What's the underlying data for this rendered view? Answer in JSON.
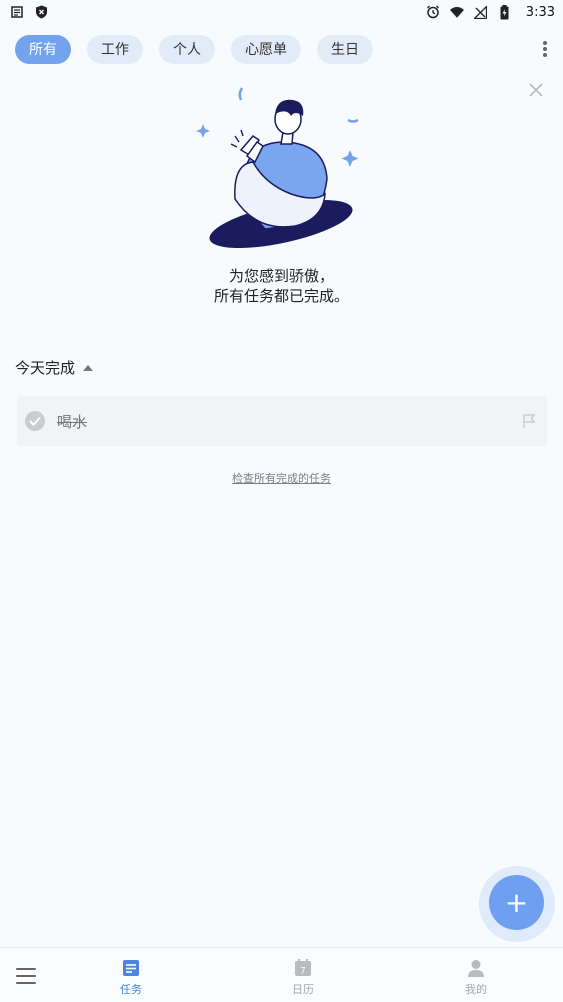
{
  "status_bar": {
    "time": "3:33",
    "left_icons": [
      "notification-icon",
      "shield-icon"
    ],
    "right_icons": [
      "alarm-icon",
      "wifi-icon",
      "no-signal-icon",
      "battery-charging-icon"
    ]
  },
  "filters": {
    "chips": [
      {
        "label": "所有",
        "active": true
      },
      {
        "label": "工作",
        "active": false
      },
      {
        "label": "个人",
        "active": false
      },
      {
        "label": "心愿单",
        "active": false
      },
      {
        "label": "生日",
        "active": false
      }
    ]
  },
  "empty_state": {
    "line1": "为您感到骄傲，",
    "line2": "所有任务都已完成。"
  },
  "completed_section": {
    "title": "今天完成",
    "tasks": [
      {
        "text": "喝水",
        "done": true
      }
    ],
    "view_all_link": "检查所有完成的任务"
  },
  "fab": {
    "label": "+"
  },
  "bottom_nav": {
    "items": [
      {
        "label": "任务",
        "icon": "tasks-icon",
        "active": true
      },
      {
        "label": "日历",
        "icon": "calendar-icon",
        "active": false,
        "badge": "7"
      },
      {
        "label": "我的",
        "icon": "profile-icon",
        "active": false
      }
    ]
  },
  "colors": {
    "accent": "#73a3ec",
    "chip_bg": "#e2ecf8",
    "nav_active": "#4a86e0",
    "background": "#f7fbfd"
  }
}
